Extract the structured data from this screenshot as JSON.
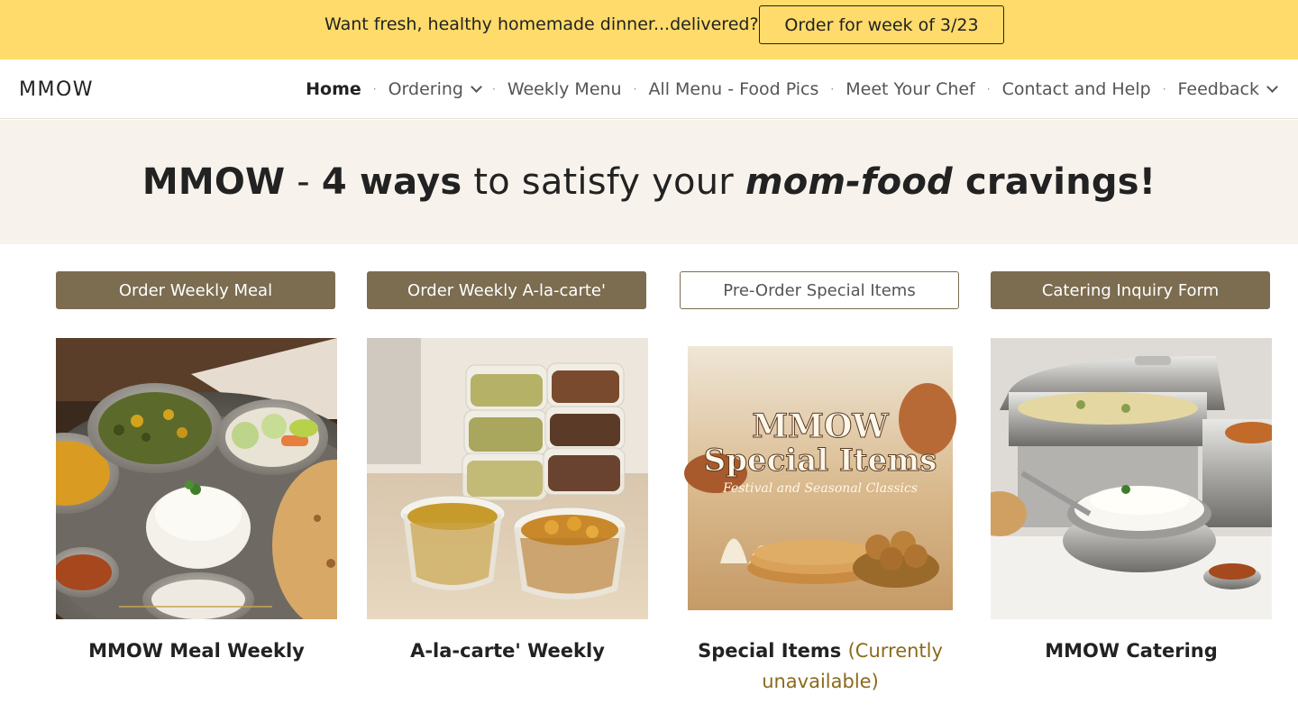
{
  "announcement": {
    "text": "Want fresh, healthy homemade dinner...delivered?",
    "button_label": "Order for week of 3/23"
  },
  "header": {
    "logo": "MMOW",
    "nav": [
      {
        "label": "Home",
        "active": true,
        "dropdown": false
      },
      {
        "label": "Ordering",
        "active": false,
        "dropdown": true
      },
      {
        "label": "Weekly Menu",
        "active": false,
        "dropdown": false
      },
      {
        "label": "All Menu - Food Pics",
        "active": false,
        "dropdown": false
      },
      {
        "label": "Meet Your Chef",
        "active": false,
        "dropdown": false
      },
      {
        "label": "Contact and Help",
        "active": false,
        "dropdown": false
      },
      {
        "label": "Feedback",
        "active": false,
        "dropdown": true
      }
    ],
    "separator": "·"
  },
  "hero": {
    "brand": "MMOW",
    "dash": " - ",
    "emphasis": "4 ways",
    "middle": " to satisfy your ",
    "italic": "mom-food",
    "end": " cravings!"
  },
  "cards": [
    {
      "button": "Order Weekly Meal",
      "caption": "MMOW Meal Weekly",
      "note": ""
    },
    {
      "button": "Order Weekly A-la-carte'",
      "caption": "A-la-carte' Weekly",
      "note": ""
    },
    {
      "button": "Pre-Order Special Items",
      "caption": "Special Items",
      "note": "(Currently unavailable)",
      "image_text": {
        "line1": "MMOW",
        "line2": "Special Items",
        "line3": "Festival and Seasonal Classics"
      }
    },
    {
      "button": "Catering Inquiry Form",
      "caption": "MMOW Catering",
      "note": ""
    }
  ],
  "colors": {
    "announcement_bg": "#fedb6b",
    "hero_bg": "#f7f3ec",
    "button_brown": "#7c6c50",
    "note_color": "#8a6a1c"
  }
}
